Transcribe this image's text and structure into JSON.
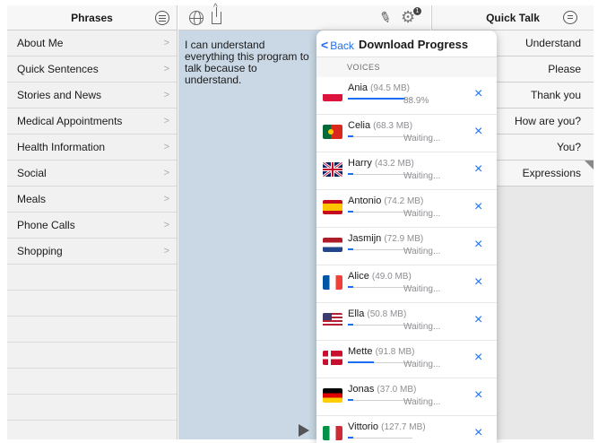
{
  "phrases_panel": {
    "title": "Phrases",
    "items": [
      {
        "label": "About Me"
      },
      {
        "label": "Quick Sentences"
      },
      {
        "label": "Stories and News"
      },
      {
        "label": "Medical Appointments"
      },
      {
        "label": "Health Information"
      },
      {
        "label": "Social"
      },
      {
        "label": "Meals"
      },
      {
        "label": "Phone Calls"
      },
      {
        "label": "Shopping"
      }
    ],
    "chevron": ">"
  },
  "editor": {
    "text": "I can understand everything this program to talk because to understand."
  },
  "quick_talk": {
    "title": "Quick Talk",
    "items": [
      {
        "label": "Understand"
      },
      {
        "label": "Please"
      },
      {
        "label": "Thank you"
      },
      {
        "label": "How are you?"
      },
      {
        "label": "You?"
      },
      {
        "label": "Expressions"
      }
    ]
  },
  "toolbar": {
    "settings_badge": "1"
  },
  "download_popover": {
    "back_label": "Back",
    "back_chevron": "<",
    "title": "Download Progress",
    "section_label": "VOICES",
    "cancel_glyph": "×",
    "voices": [
      {
        "name": "Ania",
        "size": "(94.5 MB)",
        "status": "88.9%",
        "progress": 0.889,
        "flag": "poland"
      },
      {
        "name": "Celia",
        "size": "(68.3 MB)",
        "status": "Waiting...",
        "progress": 0.0,
        "flag": "portugal"
      },
      {
        "name": "Harry",
        "size": "(43.2 MB)",
        "status": "Waiting...",
        "progress": 0.0,
        "flag": "uk"
      },
      {
        "name": "Antonio",
        "size": "(74.2 MB)",
        "status": "Waiting...",
        "progress": 0.0,
        "flag": "spain"
      },
      {
        "name": "Jasmijn",
        "size": "(72.9 MB)",
        "status": "Waiting...",
        "progress": 0.0,
        "flag": "netherlands"
      },
      {
        "name": "Alice",
        "size": "(49.0 MB)",
        "status": "Waiting...",
        "progress": 0.0,
        "flag": "france"
      },
      {
        "name": "Ella",
        "size": "(50.8 MB)",
        "status": "Waiting...",
        "progress": 0.0,
        "flag": "usa"
      },
      {
        "name": "Mette",
        "size": "(91.8 MB)",
        "status": "Waiting...",
        "progress": 0.4,
        "flag": "denmark"
      },
      {
        "name": "Jonas",
        "size": "(37.0 MB)",
        "status": "Waiting...",
        "progress": 0.0,
        "flag": "germany"
      },
      {
        "name": "Vittorio",
        "size": "(127.7 MB)",
        "status": "",
        "progress": 0.0,
        "flag": "italy"
      }
    ]
  },
  "colors": {
    "accent": "#1c6ff5",
    "editor_bg": "#c9d8e4"
  }
}
